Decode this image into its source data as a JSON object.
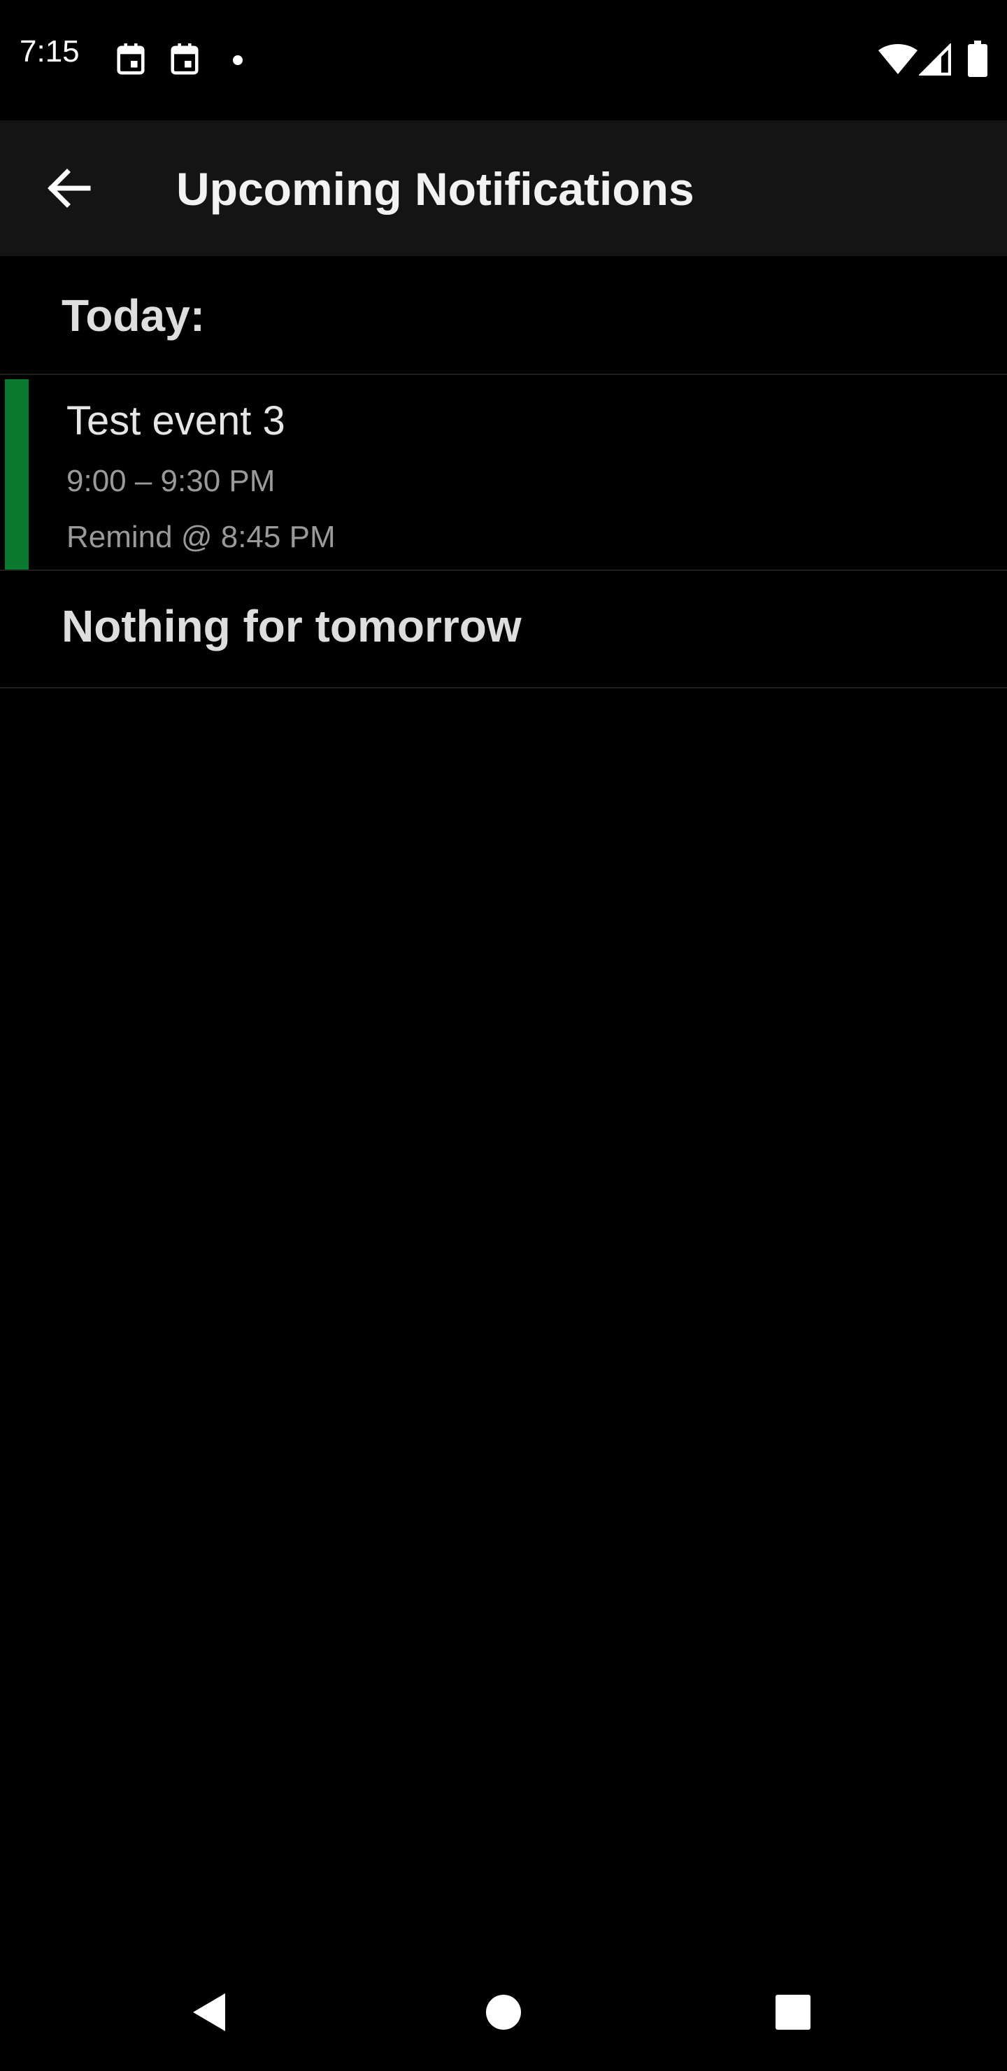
{
  "status_bar": {
    "time": "7:15",
    "icons": [
      "calendar-icon",
      "calendar-icon",
      "notification-dot",
      "wifi-icon",
      "signal-icon",
      "battery-icon"
    ]
  },
  "app_bar": {
    "title": "Upcoming Notifications",
    "back_icon": "arrow-back-icon"
  },
  "sections": {
    "today": {
      "title": "Today:",
      "events": [
        {
          "title": "Test event 3",
          "time": "9:00 – 9:30 PM",
          "remind": "Remind @ 8:45 PM",
          "color": "#0b7a2e"
        }
      ]
    },
    "tomorrow": {
      "title": "Nothing for tomorrow"
    }
  },
  "nav_bar": {
    "buttons": [
      "back-triangle-icon",
      "home-circle-icon",
      "recents-square-icon"
    ]
  },
  "colors": {
    "background": "#000000",
    "app_bar": "#141414",
    "event_accent": "#0b7a2e",
    "secondary_text": "#9a9a9a"
  }
}
